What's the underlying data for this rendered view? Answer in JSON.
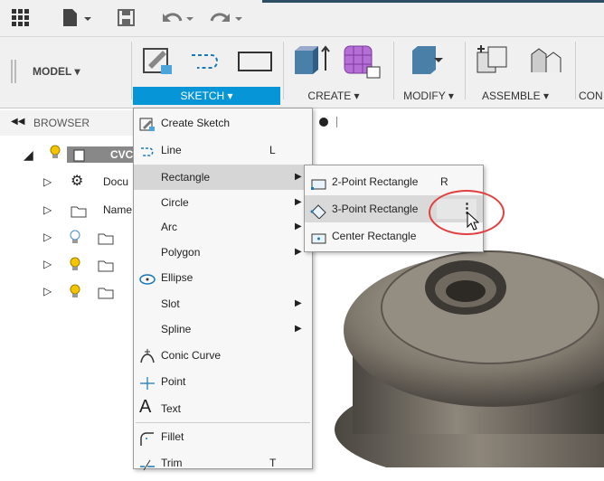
{
  "ribbon": {
    "workspace": "MODEL ▾",
    "tabs": [
      "SKETCH ▾",
      "CREATE ▾",
      "MODIFY ▾",
      "ASSEMBLE ▾",
      "CON"
    ]
  },
  "browser": {
    "title": "BROWSER",
    "root": "CVC",
    "rows": [
      "Docu",
      "Name"
    ]
  },
  "sketch_menu": {
    "items": [
      {
        "label": "Create Sketch",
        "shortcut": ""
      },
      {
        "label": "Line",
        "shortcut": "L"
      },
      {
        "label": "Rectangle",
        "shortcut": ""
      },
      {
        "label": "Circle",
        "shortcut": ""
      },
      {
        "label": "Arc",
        "shortcut": ""
      },
      {
        "label": "Polygon",
        "shortcut": ""
      },
      {
        "label": "Ellipse",
        "shortcut": ""
      },
      {
        "label": "Slot",
        "shortcut": ""
      },
      {
        "label": "Spline",
        "shortcut": ""
      },
      {
        "label": "Conic Curve",
        "shortcut": ""
      },
      {
        "label": "Point",
        "shortcut": ""
      },
      {
        "label": "Text",
        "shortcut": ""
      },
      {
        "label": "Fillet",
        "shortcut": ""
      },
      {
        "label": "Trim",
        "shortcut": "T"
      }
    ]
  },
  "rectangle_submenu": {
    "items": [
      {
        "label": "2-Point Rectangle",
        "shortcut": "R"
      },
      {
        "label": "3-Point Rectangle",
        "shortcut": ""
      },
      {
        "label": "Center Rectangle",
        "shortcut": ""
      }
    ],
    "more_icon": "⋮"
  }
}
